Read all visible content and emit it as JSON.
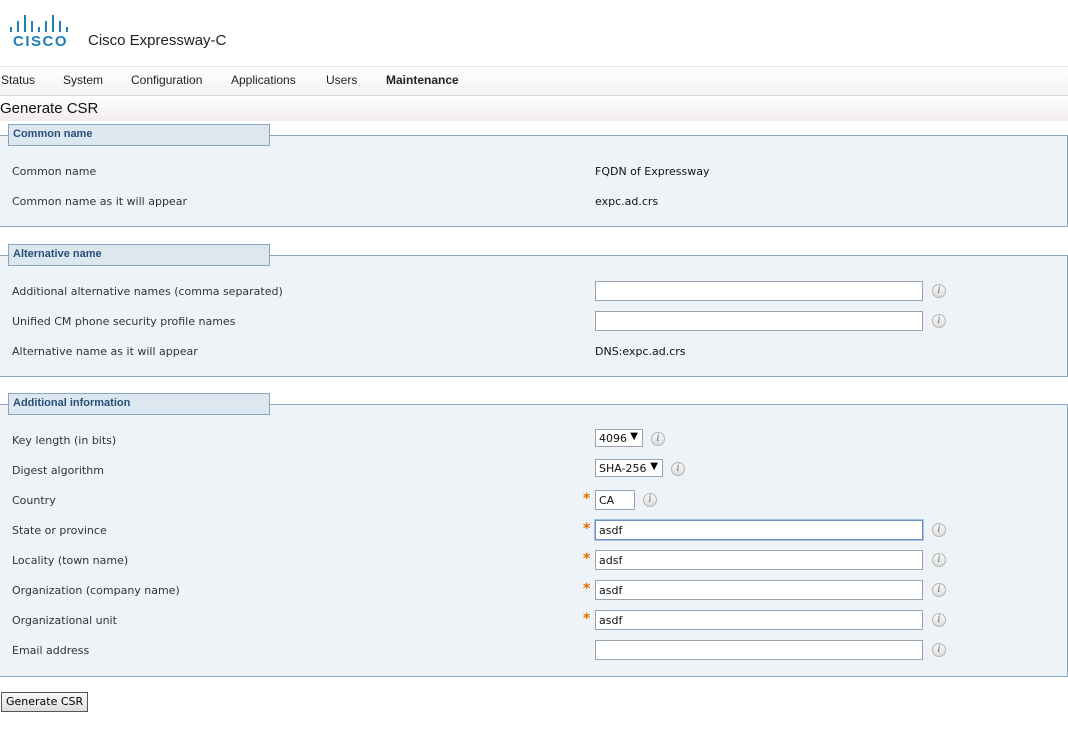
{
  "brand": {
    "logo_text": "cisco",
    "logo_display": "CISCO",
    "product": "Cisco Expressway-C"
  },
  "nav": [
    "Status",
    "System",
    "Configuration",
    "Applications",
    "Users",
    "Maintenance"
  ],
  "nav_active": "Maintenance",
  "page_title": "Generate CSR",
  "common_name": {
    "title": "Common name",
    "rows": [
      {
        "label": "Common name",
        "value": "FQDN of Expressway"
      },
      {
        "label": "Common name as it will appear",
        "value": "expc.ad.crs"
      }
    ]
  },
  "alternative_name": {
    "title": "Alternative name",
    "additional_label": "Additional alternative names (comma separated)",
    "additional_value": "",
    "ucm_label": "Unified CM phone security profile names",
    "ucm_value": "",
    "appear_label": "Alternative name as it will appear",
    "appear_value": "DNS:expc.ad.crs"
  },
  "additional_info": {
    "title": "Additional information",
    "key_length": {
      "label": "Key length (in bits)",
      "value": "4096"
    },
    "digest": {
      "label": "Digest algorithm",
      "value": "SHA-256"
    },
    "country": {
      "label": "Country",
      "value": "CA"
    },
    "state": {
      "label": "State or province",
      "value": "asdf"
    },
    "locality": {
      "label": "Locality (town name)",
      "value": "adsf"
    },
    "organization": {
      "label": "Organization (company name)",
      "value": "asdf"
    },
    "org_unit": {
      "label": "Organizational unit",
      "value": "asdf"
    },
    "email": {
      "label": "Email address",
      "value": ""
    }
  },
  "required_marker": "*",
  "info_glyph": "i",
  "dropdown_arrow": "▼",
  "generate_button": "Generate CSR",
  "colors": {
    "brand_blue": "#1f7fb8",
    "section_bg": "#eef3f7",
    "section_border": "#8aa5bf",
    "section_title": "#28507a",
    "required": "#e07000"
  }
}
